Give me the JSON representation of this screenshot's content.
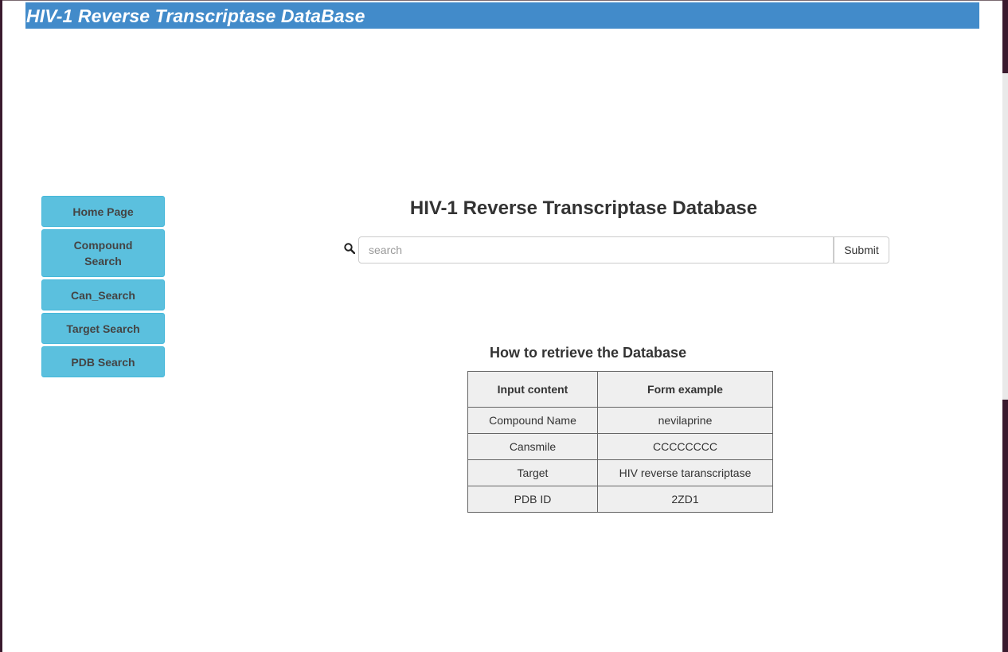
{
  "header": {
    "title": "HIV-1 Reverse Transcriptase DataBase"
  },
  "sidebar": {
    "items": [
      {
        "label": "Home Page"
      },
      {
        "label": "Compound Search"
      },
      {
        "label": "Can_Search"
      },
      {
        "label": "Target Search"
      },
      {
        "label": "PDB Search"
      }
    ]
  },
  "main": {
    "title": "HIV-1 Reverse Transcriptase Database",
    "search": {
      "placeholder": "search",
      "value": "",
      "submit_label": "Submit",
      "icon": "search-icon"
    },
    "howto": {
      "title": "How to retrieve the Database",
      "headers": [
        "Input content",
        "Form example"
      ],
      "rows": [
        [
          "Compound Name",
          "nevilaprine"
        ],
        [
          "Cansmile",
          "CCCCCCCC"
        ],
        [
          "Target",
          "HIV reverse taranscriptase"
        ],
        [
          "PDB ID",
          "2ZD1"
        ]
      ]
    }
  },
  "colors": {
    "header_bg": "#428bca",
    "nav_button_bg": "#5bc0de",
    "table_bg": "#efefef"
  }
}
